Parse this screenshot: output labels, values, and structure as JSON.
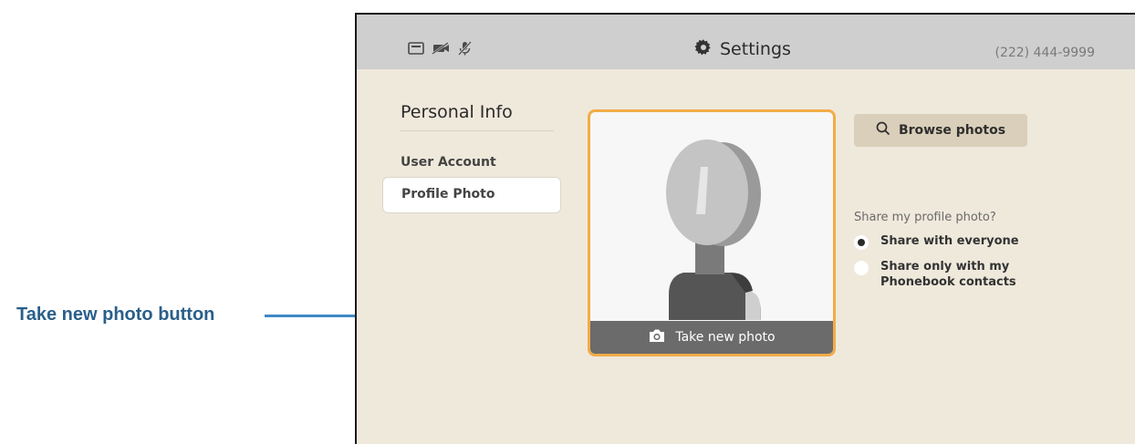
{
  "annotation": {
    "label": "Take new photo button",
    "arrow_color": "#3f87c6",
    "label_color": "#2a5f8a"
  },
  "header": {
    "title": "Settings",
    "title_icon": "gear-icon",
    "phone_number": "(222) 444-9999",
    "status_icons": [
      "video-icon",
      "camera-off-icon",
      "mic-off-icon"
    ]
  },
  "sidebar": {
    "heading": "Personal Info",
    "items": [
      {
        "label": "User Account",
        "selected": false
      },
      {
        "label": "Profile Photo",
        "selected": true
      }
    ]
  },
  "photo": {
    "take_photo_label": "Take new photo",
    "take_photo_icon": "camera-icon",
    "border_color": "#f2ac48"
  },
  "browse": {
    "label": "Browse photos",
    "icon": "search-icon"
  },
  "share": {
    "question": "Share my profile photo?",
    "options": [
      {
        "label": "Share with everyone",
        "selected": true
      },
      {
        "label": "Share only with my Phonebook contacts",
        "selected": false
      }
    ]
  }
}
